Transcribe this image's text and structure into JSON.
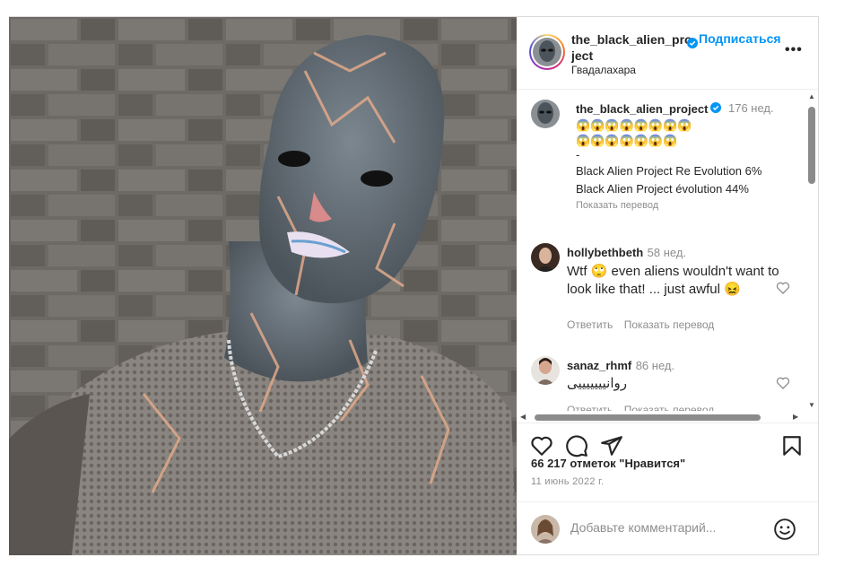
{
  "post": {
    "username": "the_black_alien_project",
    "username_display": "the_black_alien_pro ject",
    "follow_label": "Подписаться",
    "location": "Гвадалахара",
    "more_label": "•••",
    "verified": true
  },
  "caption": {
    "username": "the_black_alien_project",
    "age": "176 нед.",
    "emoji_line1": "😱😱😱😱😱😱😱😱",
    "emoji_line2": "😱😱😱😱😱😱😱",
    "dash": "-",
    "line1": "Black Alien Project Re Evolution 6%",
    "line2": "Black Alien Project évolution 44%",
    "translate_label": "Показать перевод"
  },
  "comments": [
    {
      "username": "hollybethbeth",
      "age": "58 нед.",
      "text": "Wtf 🙄 even aliens wouldn't want to look like that! ... just awful 😖",
      "reply_label": "Ответить",
      "translate_label": "Показать перевод"
    },
    {
      "username": "sanaz_rhmf",
      "age": "86 нед.",
      "text": "روانیییییییی",
      "reply_label": "Ответить",
      "translate_label": "Показать перевод"
    }
  ],
  "actions": {
    "like_icon": "heart-icon",
    "comment_icon": "comment-icon",
    "share_icon": "share-icon",
    "save_icon": "bookmark-icon"
  },
  "likes_text": "66 217 отметок \"Нравится\"",
  "date_text": "11 июнь 2022 г.",
  "add_comment": {
    "placeholder": "Добавьте комментарий..."
  },
  "colors": {
    "link": "#0095f6",
    "verified": "#0095f6",
    "muted": "#8e8e8e"
  }
}
